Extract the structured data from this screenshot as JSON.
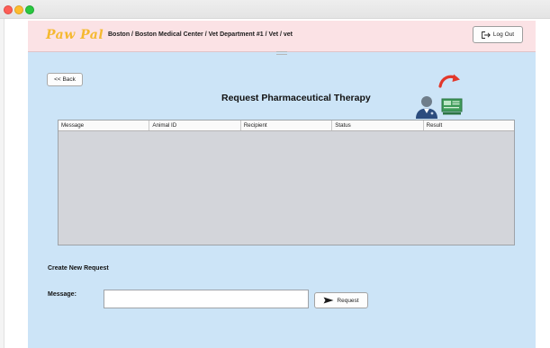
{
  "app": {
    "brand": "Paw Pal",
    "breadcrumb": "Boston / Boston Medical Center / Vet Department #1 / Vet / vet"
  },
  "header": {
    "logout_label": "Log Out"
  },
  "nav": {
    "back_label": "<< Back"
  },
  "main": {
    "title": "Request Pharmaceutical Therapy",
    "table": {
      "columns": [
        "Message",
        "Animal ID",
        "Recipient",
        "Status",
        "Result"
      ],
      "rows": []
    }
  },
  "form": {
    "section_title": "Create New Request",
    "message_label": "Message:",
    "message_value": "",
    "submit_label": "Request"
  },
  "icons": {
    "logout": "logout-icon",
    "doctor": "doctor-avatar-icon",
    "redirect": "curved-arrow-icon",
    "board": "presentation-board-icon",
    "send": "send-arrow-icon"
  }
}
